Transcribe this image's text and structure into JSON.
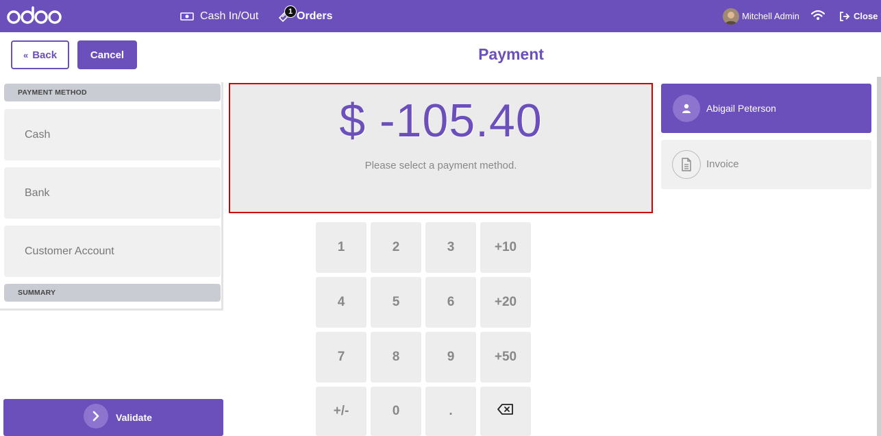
{
  "topbar": {
    "logo_text": "odoo",
    "cash_label": "Cash In/Out",
    "orders_label": "Orders",
    "orders_count": "1",
    "user_name": "Mitchell Admin",
    "close_label": "Close",
    "bg_color": "#6b4fbb"
  },
  "header": {
    "back_label": "Back",
    "cancel_label": "Cancel",
    "title": "Payment"
  },
  "left": {
    "payment_method_heading": "PAYMENT METHOD",
    "methods": [
      "Cash",
      "Bank",
      "Customer Account"
    ],
    "summary_heading": "SUMMARY",
    "validate_label": "Validate"
  },
  "amount": {
    "value": "$ -105.40",
    "message": "Please select a payment method."
  },
  "numpad": {
    "keys": [
      "1",
      "2",
      "3",
      "+10",
      "4",
      "5",
      "6",
      "+20",
      "7",
      "8",
      "9",
      "+50",
      "+/-",
      "0",
      ".",
      "backspace"
    ]
  },
  "right": {
    "customer_name": "Abigail Peterson",
    "invoice_label": "Invoice"
  },
  "colors": {
    "accent": "#6b4fbb",
    "error_border": "#d10000"
  }
}
